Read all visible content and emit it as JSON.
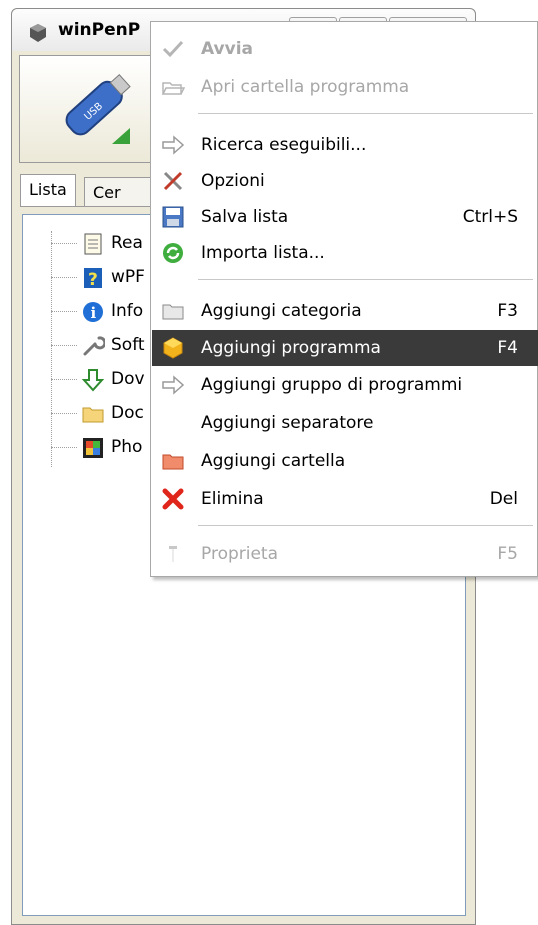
{
  "window": {
    "title": "winPenP",
    "tabs": [
      "Lista",
      "Cer"
    ]
  },
  "tree": {
    "items": [
      {
        "label": "Rea",
        "icon": "notepad-icon"
      },
      {
        "label": "wPF",
        "icon": "help-icon"
      },
      {
        "label": "Info",
        "icon": "info-icon"
      },
      {
        "label": "Soft",
        "icon": "wrench-icon"
      },
      {
        "label": "Dov",
        "icon": "download-arrow-icon"
      },
      {
        "label": "Doc",
        "icon": "folder-icon"
      },
      {
        "label": "Pho",
        "icon": "film-icon"
      }
    ]
  },
  "menu": {
    "items": [
      {
        "label": "Avvia",
        "shortcut": "",
        "icon": "check-icon",
        "disabled": true,
        "bold": true
      },
      {
        "label": "Apri cartella programma",
        "shortcut": "",
        "icon": "open-folder-icon",
        "disabled": true
      },
      {
        "label": "Ricerca eseguibili...",
        "shortcut": "",
        "icon": "arrow-right-icon"
      },
      {
        "label": "Opzioni",
        "shortcut": "",
        "icon": "tools-icon"
      },
      {
        "label": "Salva lista",
        "shortcut": "Ctrl+S",
        "icon": "save-icon"
      },
      {
        "label": "Importa lista...",
        "shortcut": "",
        "icon": "refresh-icon"
      },
      {
        "label": "Aggiungi categoria",
        "shortcut": "F3",
        "icon": "folder-icon"
      },
      {
        "label": "Aggiungi programma",
        "shortcut": "F4",
        "icon": "box-icon",
        "highlighted": true
      },
      {
        "label": "Aggiungi gruppo di programmi",
        "shortcut": "",
        "icon": "arrow-right-icon"
      },
      {
        "label": "Aggiungi separatore",
        "shortcut": "",
        "icon": ""
      },
      {
        "label": "Aggiungi cartella",
        "shortcut": "",
        "icon": "red-folder-icon"
      },
      {
        "label": "Elimina",
        "shortcut": "Del",
        "icon": "delete-x-icon"
      },
      {
        "label": "Proprieta",
        "shortcut": "F5",
        "icon": "properties-icon",
        "disabled": true
      }
    ]
  },
  "colors": {
    "highlight": "#3a3a3a",
    "disabled_text": "#a7a7a7"
  }
}
